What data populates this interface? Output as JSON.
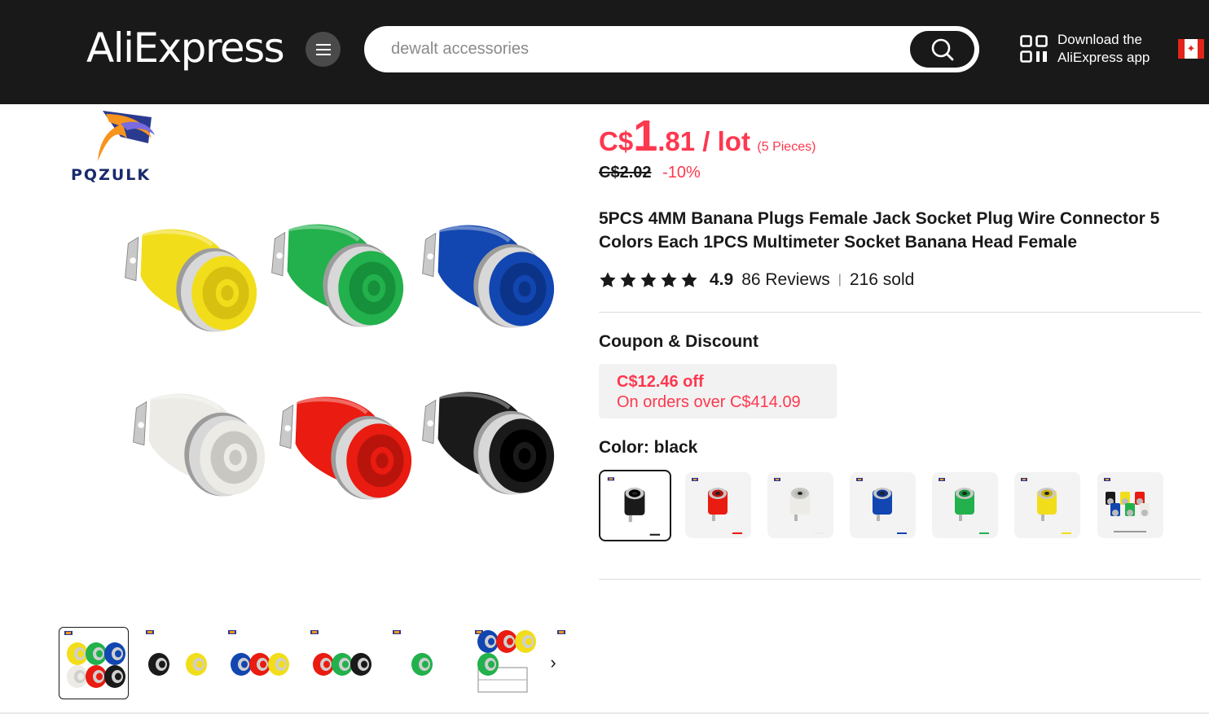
{
  "header": {
    "logo_text": "AliExpress",
    "search": {
      "placeholder": "dewalt accessories"
    },
    "app_download": {
      "line1": "Download the",
      "line2": "AliExpress app"
    },
    "region_flag": "canada-flag-icon"
  },
  "brand": {
    "name": "PQZULK"
  },
  "product": {
    "price": {
      "currency": "C$",
      "integer": "1",
      "decimal": ".81",
      "unit": " / lot",
      "pieces": "(5 Pieces)"
    },
    "original_price": "C$2.02",
    "discount": "-10%",
    "title": "5PCS 4MM Banana Plugs Female Jack Socket Plug Wire Connector 5 Colors Each 1PCS Multimeter Socket Banana Head Female",
    "rating": {
      "stars": 5,
      "score": "4.9",
      "reviews": "86 Reviews",
      "separator": "|",
      "sold": "216 sold"
    },
    "coupon": {
      "heading": "Coupon & Discount",
      "amount": "C$12.46 off",
      "condition": "On orders over C$414.09"
    },
    "color": {
      "heading": "Color: black",
      "selected": "black",
      "options": [
        "black",
        "red",
        "white",
        "blue",
        "green",
        "yellow",
        "mixed"
      ]
    }
  },
  "gallery": {
    "main_image": "six banana jack sockets in yellow, green, blue, white, red, black",
    "thumbnails": [
      "all-colors",
      "black-yellow",
      "blue-red",
      "red-green-black",
      "green-dimensions",
      "drawing-dimensions",
      "more"
    ],
    "active_index": 0
  },
  "colors": {
    "header_bg": "#191919",
    "price_red": "#fd384f",
    "yellow": "#f2dd1b",
    "green": "#22b14c",
    "blue": "#1246b0",
    "white": "#ecebe6",
    "red": "#ea1b10",
    "black": "#1a1a1a",
    "metal": "#c8c8c8"
  }
}
